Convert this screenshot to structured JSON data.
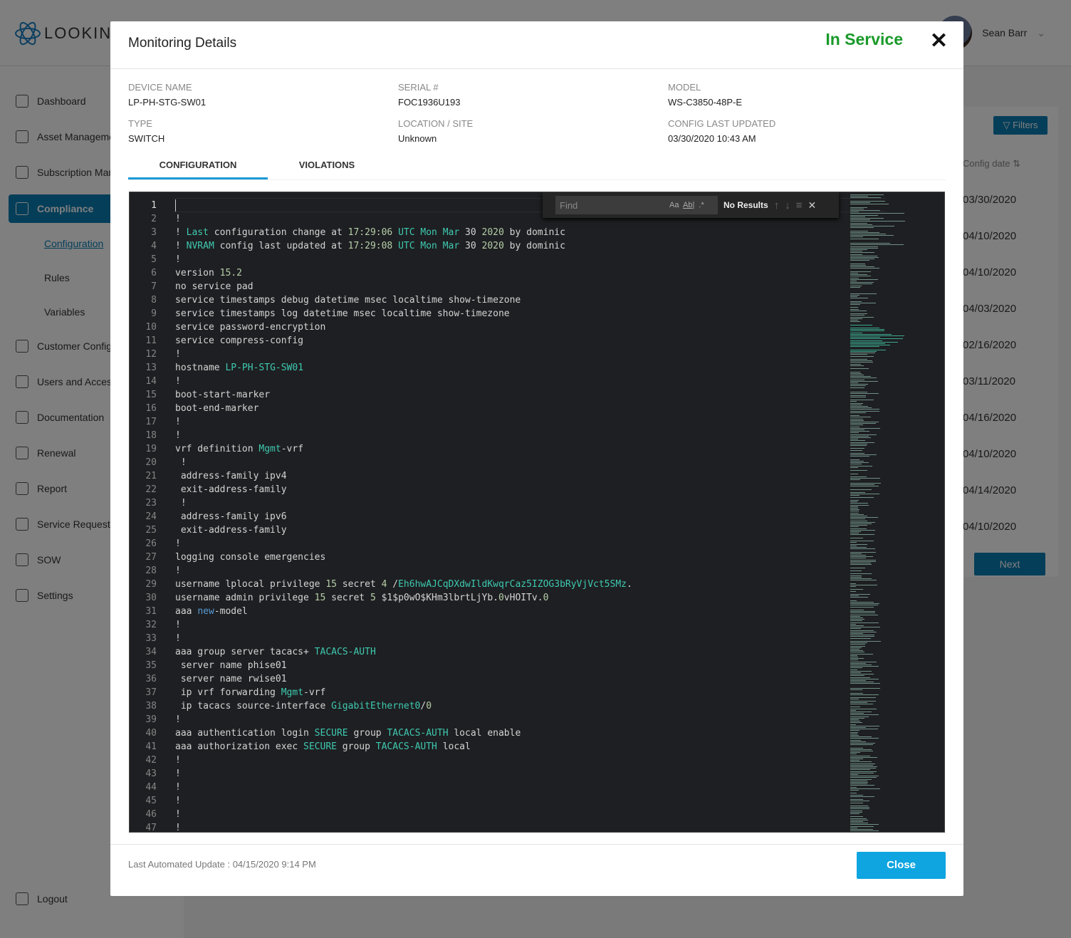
{
  "app": {
    "logo_text": "LOOKING",
    "user_name": "Sean Barr"
  },
  "sidebar": {
    "items": [
      {
        "label": "Dashboard",
        "icon": "home-icon"
      },
      {
        "label": "Asset Management",
        "icon": "asset-icon"
      },
      {
        "label": "Subscription Management",
        "icon": "subscription-icon"
      },
      {
        "label": "Compliance",
        "icon": "compliance-icon",
        "active": true
      },
      {
        "label": "Customer Configuration",
        "icon": "customer-icon"
      },
      {
        "label": "Users and Access",
        "icon": "users-icon"
      },
      {
        "label": "Documentation",
        "icon": "document-icon"
      },
      {
        "label": "Renewal",
        "icon": "renewal-icon"
      },
      {
        "label": "Report",
        "icon": "report-icon"
      },
      {
        "label": "Service Request",
        "icon": "service-icon"
      },
      {
        "label": "SOW",
        "icon": "sow-icon"
      },
      {
        "label": "Settings",
        "icon": "gear-icon"
      }
    ],
    "sub_items": [
      "Configuration",
      "Rules",
      "Variables"
    ],
    "logout": "Logout"
  },
  "background_table": {
    "filters": "Filters",
    "column": "Config date",
    "dates": [
      "03/30/2020",
      "04/10/2020",
      "04/10/2020",
      "04/03/2020",
      "02/16/2020",
      "03/11/2020",
      "04/16/2020",
      "04/10/2020",
      "04/14/2020",
      "04/10/2020"
    ],
    "next": "Next"
  },
  "modal": {
    "title": "Monitoring Details",
    "status": "In Service",
    "status_color": "#1a9a2a",
    "fields": [
      {
        "label": "DEVICE NAME",
        "value": "LP-PH-STG-SW01"
      },
      {
        "label": "SERIAL #",
        "value": "FOC1936U193"
      },
      {
        "label": "MODEL",
        "value": "WS-C3850-48P-E"
      },
      {
        "label": "TYPE",
        "value": "SWITCH"
      },
      {
        "label": "LOCATION / SITE",
        "value": "Unknown"
      },
      {
        "label": "CONFIG LAST UPDATED",
        "value": "03/30/2020 10:43 AM"
      }
    ],
    "tabs": [
      "CONFIGURATION",
      "VIOLATIONS"
    ],
    "find": {
      "placeholder": "Find",
      "case": "Aa",
      "word": "Ab|",
      "regex": ".*",
      "result": "No Results"
    },
    "last_update": "Last Automated Update : 04/15/2020 9:14 PM",
    "close": "Close"
  },
  "config_lines": [
    [],
    [
      [
        "!"
      ]
    ],
    [
      [
        "! "
      ],
      [
        "Last",
        "k"
      ],
      [
        " configuration change at "
      ],
      [
        "17:29:06",
        "n"
      ],
      [
        " "
      ],
      [
        "UTC",
        "k"
      ],
      [
        " "
      ],
      [
        "Mon",
        "k"
      ],
      [
        " "
      ],
      [
        "Mar",
        "k"
      ],
      [
        " 30 "
      ],
      [
        "2020",
        "n"
      ],
      [
        " by dominic"
      ]
    ],
    [
      [
        "! "
      ],
      [
        "NVRAM",
        "k"
      ],
      [
        " config last updated at "
      ],
      [
        "17:29:08",
        "n"
      ],
      [
        " "
      ],
      [
        "UTC",
        "k"
      ],
      [
        " "
      ],
      [
        "Mon",
        "k"
      ],
      [
        " "
      ],
      [
        "Mar",
        "k"
      ],
      [
        " 30 "
      ],
      [
        "2020",
        "n"
      ],
      [
        " by dominic"
      ]
    ],
    [
      [
        "!"
      ]
    ],
    [
      [
        "version "
      ],
      [
        "15.2",
        "n"
      ]
    ],
    [
      [
        "no service pad"
      ]
    ],
    [
      [
        "service timestamps debug datetime msec localtime show-timezone"
      ]
    ],
    [
      [
        "service timestamps log datetime msec localtime show-timezone"
      ]
    ],
    [
      [
        "service password-encryption"
      ]
    ],
    [
      [
        "service compress-config"
      ]
    ],
    [
      [
        "!"
      ]
    ],
    [
      [
        "hostname "
      ],
      [
        "LP-PH-STG-SW01",
        "k"
      ]
    ],
    [
      [
        "!"
      ]
    ],
    [
      [
        "boot-start-marker"
      ]
    ],
    [
      [
        "boot-end-marker"
      ]
    ],
    [
      [
        "!"
      ]
    ],
    [
      [
        "!"
      ]
    ],
    [
      [
        "vrf definition "
      ],
      [
        "Mgmt",
        "k"
      ],
      [
        "-vrf"
      ]
    ],
    [
      [
        " !"
      ]
    ],
    [
      [
        " address-family ipv4"
      ]
    ],
    [
      [
        " exit-address-family"
      ]
    ],
    [
      [
        " !"
      ]
    ],
    [
      [
        " address-family ipv6"
      ]
    ],
    [
      [
        " exit-address-family"
      ]
    ],
    [
      [
        "!"
      ]
    ],
    [
      [
        "logging console emergencies"
      ]
    ],
    [
      [
        "!"
      ]
    ],
    [
      [
        "username lplocal privilege "
      ],
      [
        "15",
        "n"
      ],
      [
        " secret "
      ],
      [
        "4",
        "n"
      ],
      [
        " /"
      ],
      [
        "Eh6hwAJCqDXdwIldKwqrCaz5IZOG3bRyVjVct5SMz",
        "k"
      ],
      [
        "."
      ]
    ],
    [
      [
        "username admin privilege "
      ],
      [
        "15",
        "n"
      ],
      [
        " secret "
      ],
      [
        "5",
        "n"
      ],
      [
        " $1$p0wO$KHm3lbrtLjYb."
      ],
      [
        "0",
        "n"
      ],
      [
        "vHOITv."
      ],
      [
        "0",
        "n"
      ]
    ],
    [
      [
        "aaa "
      ],
      [
        "new",
        "b"
      ],
      [
        "-model"
      ]
    ],
    [
      [
        "!"
      ]
    ],
    [
      [
        "!"
      ]
    ],
    [
      [
        "aaa group server tacacs+ "
      ],
      [
        "TACACS-AUTH",
        "k"
      ]
    ],
    [
      [
        " server name phise01"
      ]
    ],
    [
      [
        " server name rwise01"
      ]
    ],
    [
      [
        " ip vrf forwarding "
      ],
      [
        "Mgmt",
        "k"
      ],
      [
        "-vrf"
      ]
    ],
    [
      [
        " ip tacacs source-interface "
      ],
      [
        "GigabitEthernet0",
        "k"
      ],
      [
        "/"
      ],
      [
        "0",
        "n"
      ]
    ],
    [
      [
        "!"
      ]
    ],
    [
      [
        "aaa authentication login "
      ],
      [
        "SECURE",
        "k"
      ],
      [
        " group "
      ],
      [
        "TACACS-AUTH",
        "k"
      ],
      [
        " local enable"
      ]
    ],
    [
      [
        "aaa authorization exec "
      ],
      [
        "SECURE",
        "k"
      ],
      [
        " group "
      ],
      [
        "TACACS-AUTH",
        "k"
      ],
      [
        " local"
      ]
    ],
    [
      [
        "!"
      ]
    ],
    [
      [
        "!"
      ]
    ],
    [
      [
        "!"
      ]
    ],
    [
      [
        "!"
      ]
    ],
    [
      [
        "!"
      ]
    ],
    [
      [
        "!"
      ]
    ]
  ]
}
